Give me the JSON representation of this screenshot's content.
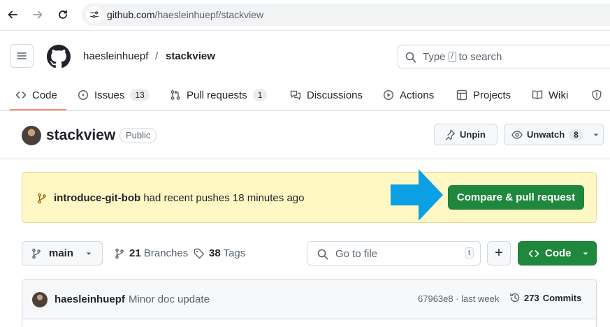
{
  "browser": {
    "url_domain": "github.com",
    "url_path": "/haesleinhuepf/stackview"
  },
  "header": {
    "owner": "haesleinhuepf",
    "separator": "/",
    "repo": "stackview",
    "search": {
      "prefix": "Type",
      "key": "/",
      "suffix": "to search"
    }
  },
  "tabs": [
    {
      "label": "Code",
      "icon": "code-icon"
    },
    {
      "label": "Issues",
      "icon": "issue-icon",
      "count": "13"
    },
    {
      "label": "Pull requests",
      "icon": "pull-request-icon",
      "count": "1"
    },
    {
      "label": "Discussions",
      "icon": "discussions-icon"
    },
    {
      "label": "Actions",
      "icon": "actions-play-icon"
    },
    {
      "label": "Projects",
      "icon": "projects-table-icon"
    },
    {
      "label": "Wiki",
      "icon": "book-icon"
    }
  ],
  "repo": {
    "name": "stackview",
    "visibility": "Public",
    "unpin_label": "Unpin",
    "watch_label": "Unwatch",
    "watch_count": "8"
  },
  "push_banner": {
    "branch": "introduce-git-bob",
    "message": "had recent pushes 18 minutes ago",
    "button_label": "Compare & pull request"
  },
  "file_nav": {
    "branch": "main",
    "branches_count": "21",
    "branches_label": "Branches",
    "tags_count": "38",
    "tags_label": "Tags",
    "goto_placeholder": "Go to file",
    "goto_key": "t",
    "add_label": "+",
    "code_label": "Code"
  },
  "latest_commit": {
    "author": "haesleinhuepf",
    "message": "Minor doc update",
    "sha_time": "67963e8 · last week",
    "commits_count": "273",
    "commits_label": "Commits"
  },
  "colors": {
    "primary_green": "#1f883d",
    "banner_yellow": "#fff8c5",
    "arrow_blue": "#0aa0e3",
    "tab_underline": "#fd8c73"
  }
}
